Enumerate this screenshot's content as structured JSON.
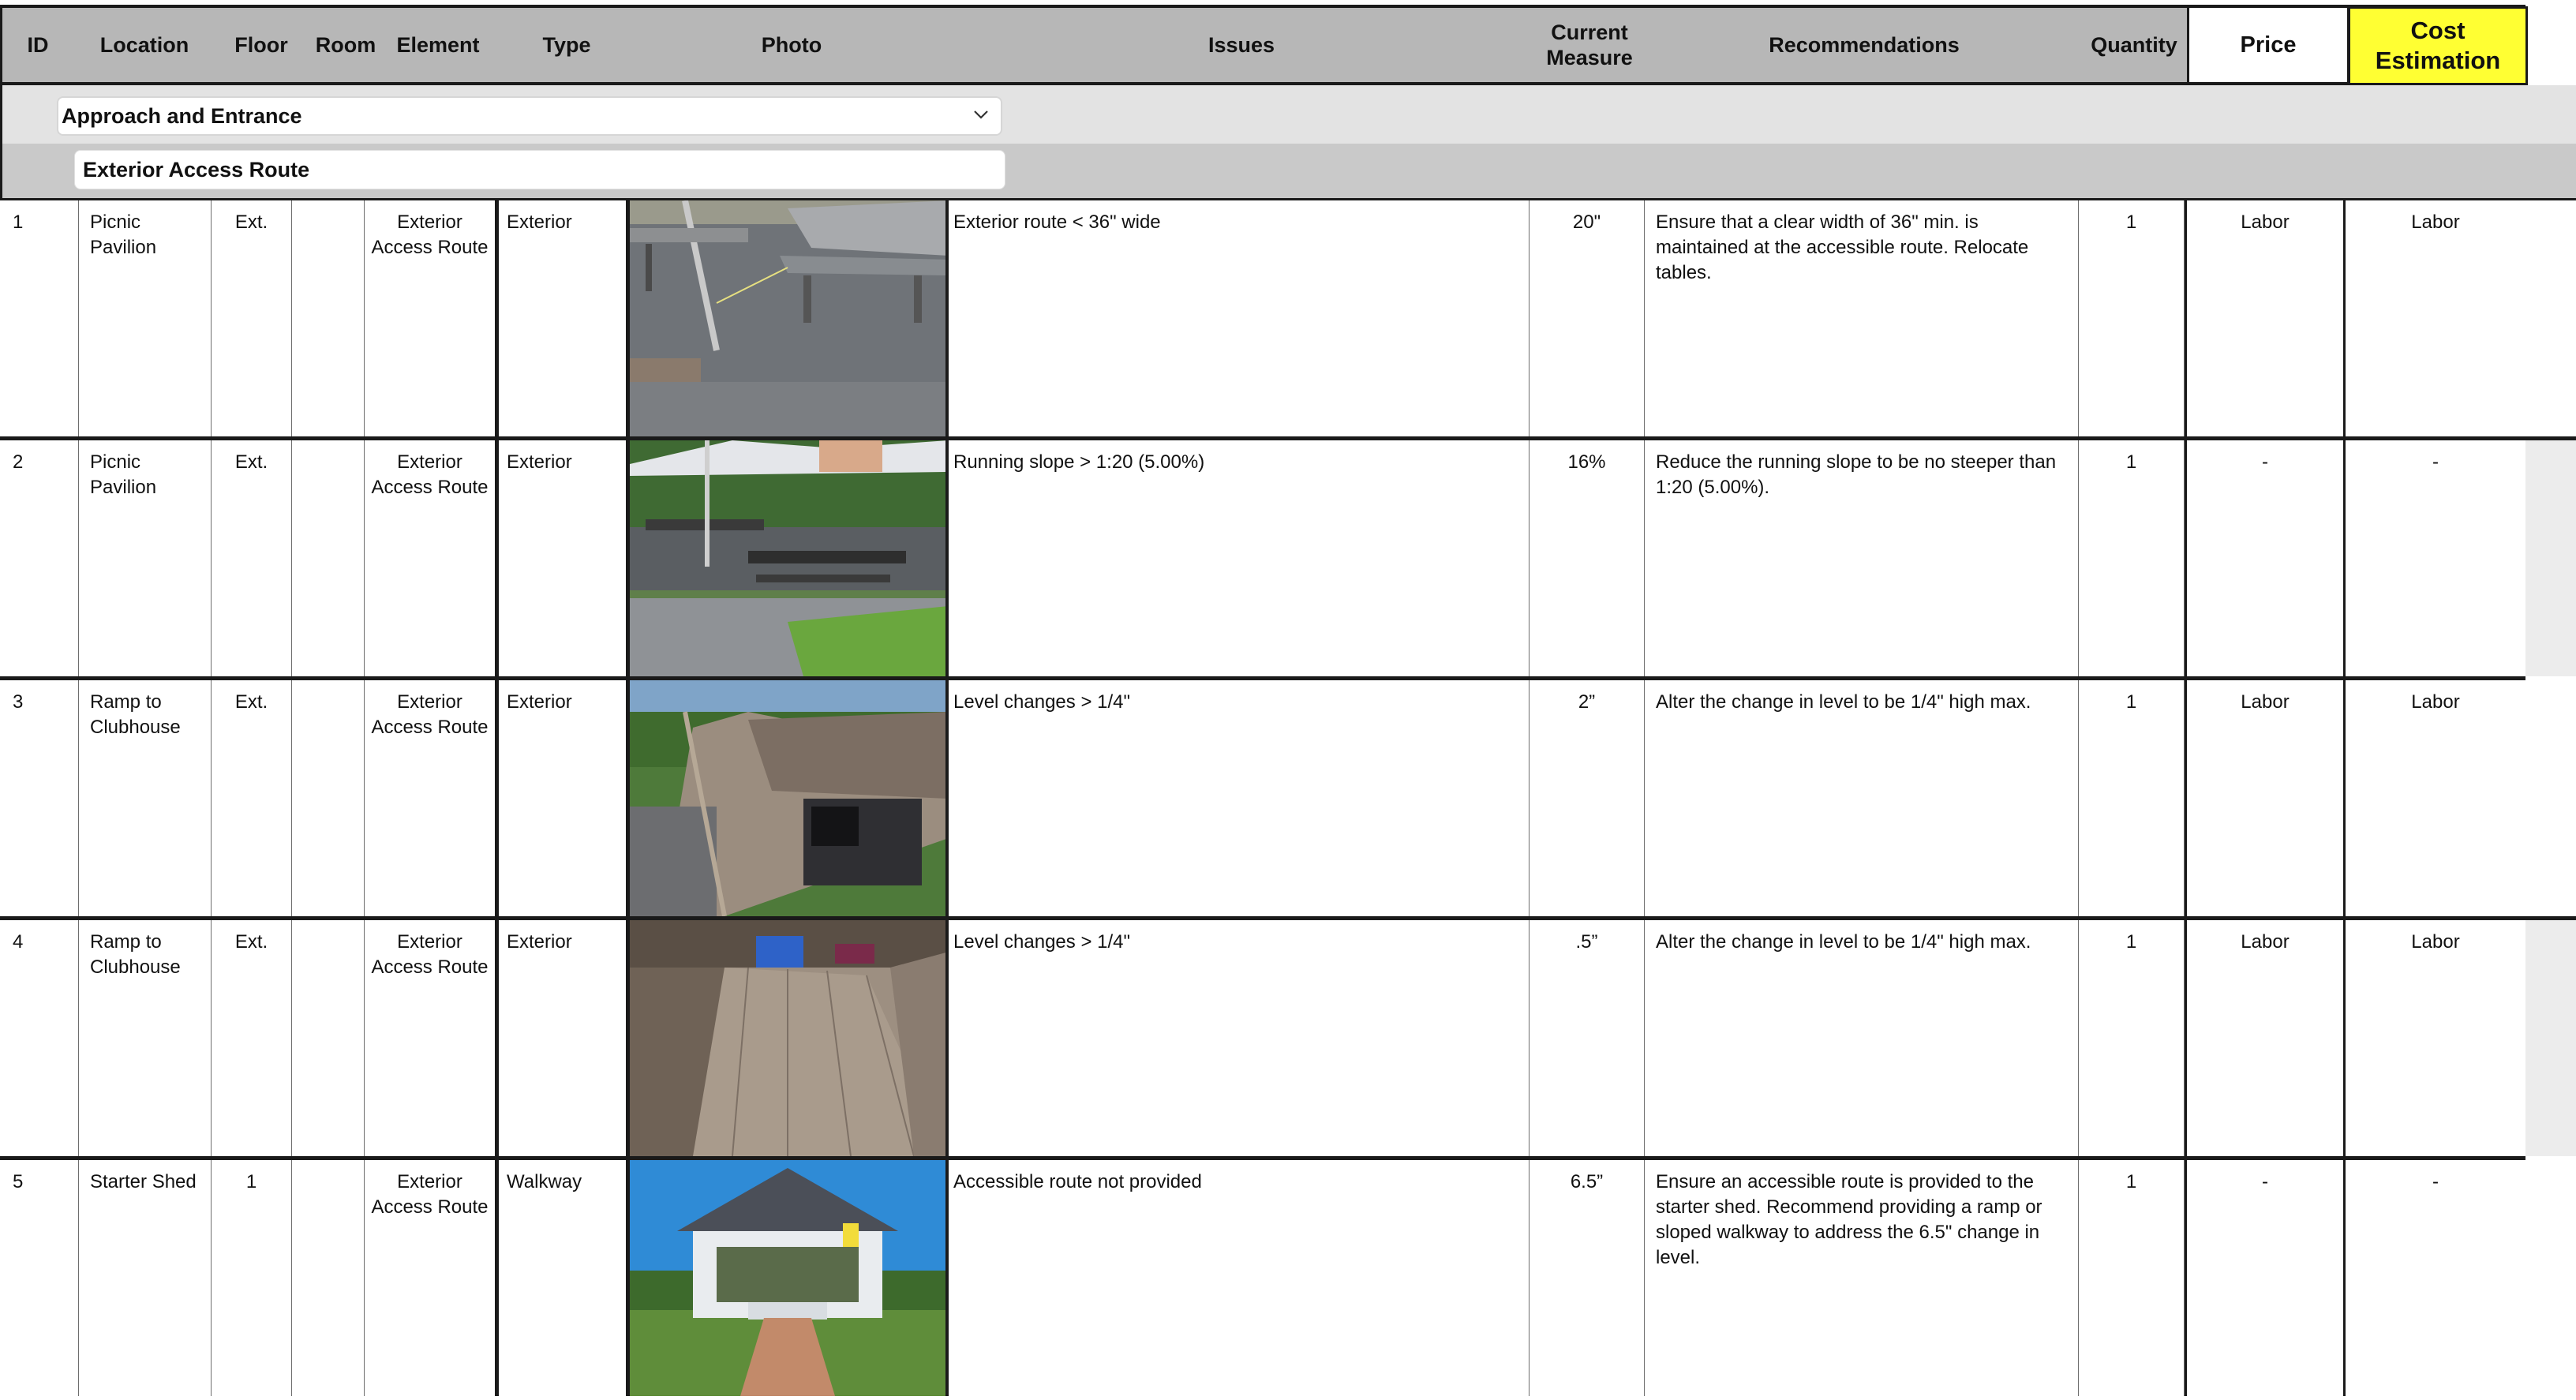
{
  "header": {
    "id": "ID",
    "location": "Location",
    "floor": "Floor",
    "room": "Room",
    "element": "Element",
    "type": "Type",
    "photo": "Photo",
    "issues": "Issues",
    "current_measure": "Current Measure",
    "recommendations": "Recommendations",
    "quantity": "Quantity",
    "price": "Price",
    "cost_estimation": "Cost Estimation"
  },
  "colors": {
    "header_bg": "#b7b7b7",
    "cost_header_bg": "#ffff33",
    "section_bg": "#e3e3e3",
    "subsection_bg": "#c9c9c9"
  },
  "section": {
    "selected": "Approach and Entrance",
    "icon": "chevron-down-icon"
  },
  "subsection": {
    "value": "Exterior Access Route"
  },
  "rows": [
    {
      "id": "1",
      "location": "Picnic Pavilion",
      "floor": "Ext.",
      "room": "",
      "element": "Exterior Access Route",
      "type": "Exterior",
      "photo": "picnic-table-photo",
      "issue": "Exterior route < 36\" wide",
      "measure": "20\"",
      "recommendation": "Ensure that a clear width of 36\" min. is maintained at the accessible route. Relocate tables.",
      "quantity": "1",
      "price": "Labor",
      "cost": "Labor"
    },
    {
      "id": "2",
      "location": "Picnic Pavilion",
      "floor": "Ext.",
      "room": "",
      "element": "Exterior Access Route",
      "type": "Exterior",
      "photo": "pavilion-tent-photo",
      "issue": "Running slope > 1:20 (5.00%)",
      "measure": "16%",
      "recommendation": "Reduce the running slope to be no steeper than 1:20 (5.00%).",
      "quantity": "1",
      "price": "-",
      "cost": "-"
    },
    {
      "id": "3",
      "location": "Ramp to Clubhouse",
      "floor": "Ext.",
      "room": "",
      "element": "Exterior Access Route",
      "type": "Exterior",
      "photo": "ramp-photo",
      "issue": "Level changes > 1/4\"",
      "measure": "2”",
      "recommendation": "Alter the change in level to be 1/4\" high max.",
      "quantity": "1",
      "price": "Labor",
      "cost": "Labor"
    },
    {
      "id": "4",
      "location": "Ramp to Clubhouse",
      "floor": "Ext.",
      "room": "",
      "element": "Exterior Access Route",
      "type": "Exterior",
      "photo": "deck-photo",
      "issue": "Level changes > 1/4\"",
      "measure": ".5”",
      "recommendation": "Alter the change in level to be 1/4\" high max.",
      "quantity": "1",
      "price": "Labor",
      "cost": "Labor"
    },
    {
      "id": "5",
      "location": "Starter Shed",
      "floor": "1",
      "room": "",
      "element": "Exterior Access Route",
      "type": "Walkway",
      "photo": "gazebo-photo",
      "issue": "Accessible route not provided",
      "measure": "6.5”",
      "recommendation": "Ensure an accessible route is provided to the starter shed. Recommend providing a ramp or sloped walkway to address the 6.5\" change in level.",
      "quantity": "1",
      "price": "-",
      "cost": "-"
    }
  ]
}
